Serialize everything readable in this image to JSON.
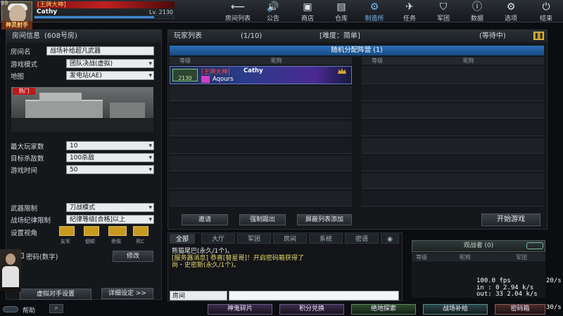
{
  "player": {
    "name_tag": "[王牌大神]",
    "name": "Cathy",
    "level": "Lv. 2130",
    "corner_num": "99",
    "badge": "神灵射手"
  },
  "nav": [
    {
      "label": "房间列表",
      "icon": "back-arrow-icon"
    },
    {
      "label": "公告",
      "icon": "speaker-icon"
    },
    {
      "label": "商店",
      "icon": "tv-icon"
    },
    {
      "label": "仓库",
      "icon": "briefcase-icon"
    },
    {
      "label": "制造所",
      "icon": "gear-factory-icon"
    },
    {
      "label": "任务",
      "icon": "mission-icon"
    },
    {
      "label": "军团",
      "icon": "shield-icon"
    },
    {
      "label": "数据",
      "icon": "info-icon"
    },
    {
      "label": "选项",
      "icon": "settings-icon"
    },
    {
      "label": "结束",
      "icon": "power-icon"
    }
  ],
  "room_info": {
    "title": "房间信息",
    "room_no": "(608号房)",
    "room_name_label": "房间名",
    "room_name": "战场补给超凡武器",
    "mode_label": "游戏模式",
    "mode": "团队决战(虚拟)",
    "map_label": "地图",
    "map": "发电站(AE)",
    "map_tag": "热门",
    "max_players_label": "最大玩家数",
    "max_players": "10",
    "kill_target_label": "目标杀敌数",
    "kill_target": "100杀敌",
    "time_label": "游戏时间",
    "time": "50",
    "weapon_limit_label": "武器限制",
    "weapon_limit": "刀战模式",
    "discipline_label": "战场纪律限制",
    "discipline": "纪律等级[合格]以上",
    "view_label": "设置视角",
    "views": [
      "友军",
      "個顿",
      "旁观",
      "死C"
    ],
    "password_label": "密码(数字)",
    "modify_btn": "修改",
    "virtual_btn": "虚拟对手设置",
    "detail_btn": "详细设定 >>",
    "help_label": "帮助"
  },
  "player_list": {
    "title": "玩家列表",
    "count": "(1/10)",
    "difficulty": "[难度：简单]",
    "status": "(等待中)",
    "team_header": "随机分配阵营 (1)",
    "col_level": "等级",
    "col_nick": "昵称",
    "slot": {
      "tag": "[王牌大神]",
      "name": "Cathy",
      "level": "2130",
      "clan": "Aqours"
    },
    "invite_btn": "邀请",
    "kick_btn": "强制踢出",
    "block_btn": "屏蔽列表添加",
    "start_btn": "开始游戏"
  },
  "chat": {
    "tabs": [
      "全部",
      "大厅",
      "军团",
      "房间",
      "系统",
      "密语"
    ],
    "lines": [
      {
        "text": "熊猫尾巴(永久/1个)。",
        "color": "#e8e8e8"
      },
      {
        "text": "[服务器消息] 恭喜[替星哥]！开启密码箱获得了",
        "color": "#e7d86a"
      },
      {
        "text": "尚・史密斯(永久/1个)。",
        "color": "#e7d86a"
      }
    ],
    "channel": "房间"
  },
  "observer": {
    "title": "观战者 (0)",
    "col_level": "等级",
    "col_nick": "昵称",
    "col_clan": "军团"
  },
  "stats": {
    "fps": "100.0 fps",
    "fps_side": "20/s",
    "in": "in :  0 2.94 k/s",
    "out": "out:  33 2.04 k/s",
    "corner": "30/s"
  },
  "bottom_buttons": [
    "神鬼碎片",
    "积分兑换",
    "绝地探索",
    "战场补给",
    "密码箱"
  ],
  "colors": {
    "accent": "#3f89d8",
    "team_bar": "#1f5fa6"
  }
}
